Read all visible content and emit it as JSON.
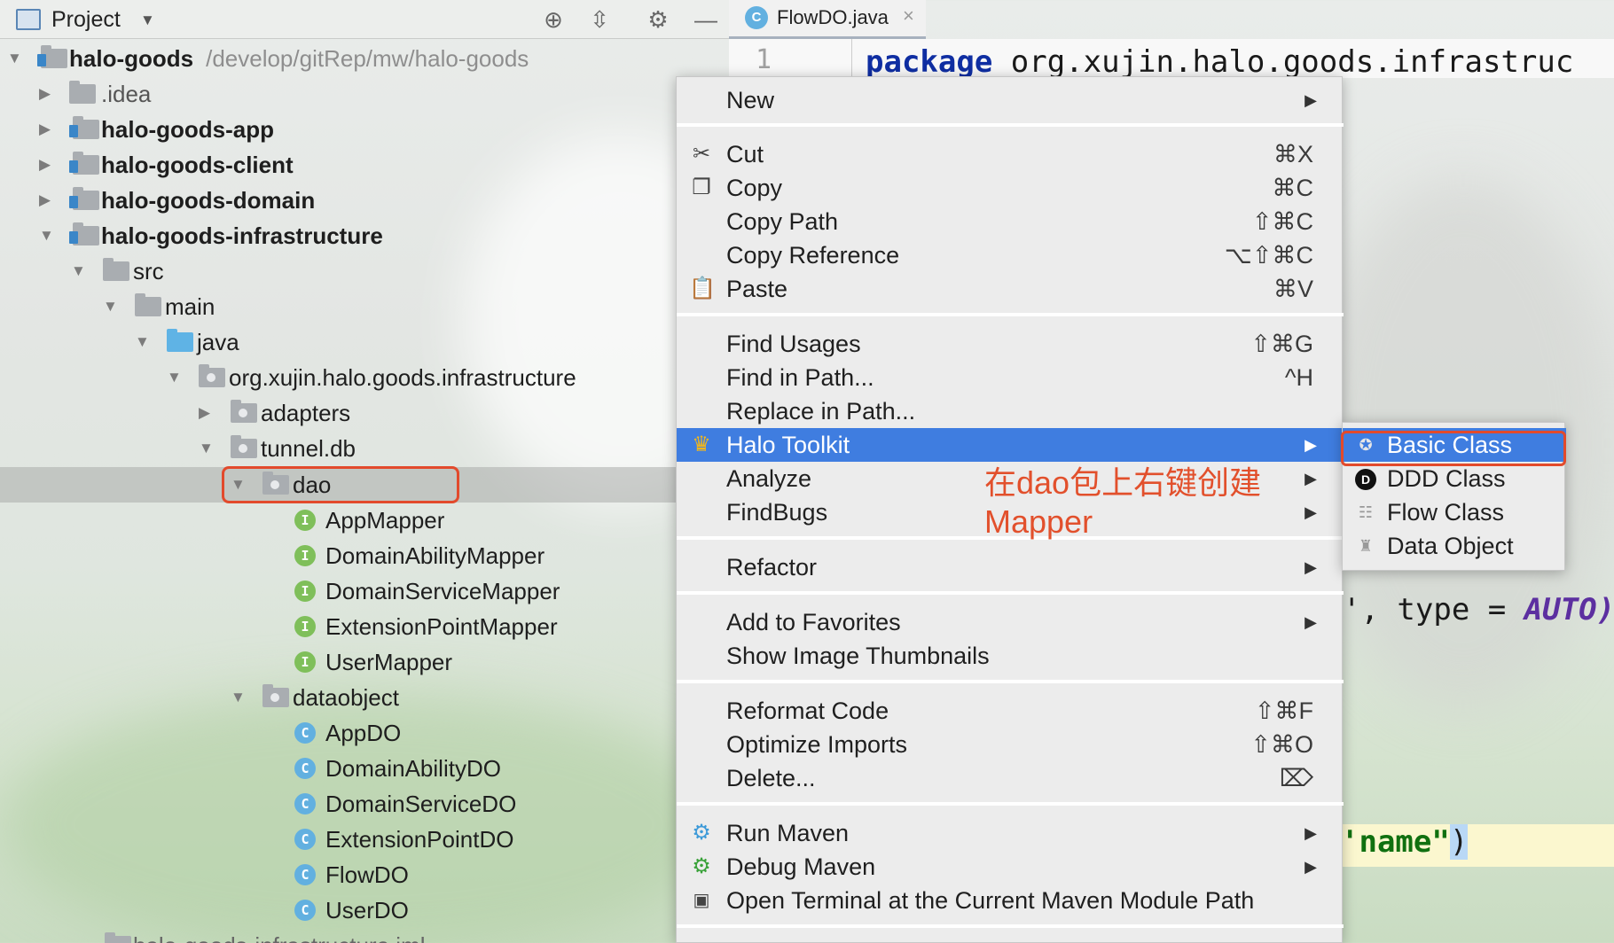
{
  "project_panel": {
    "title": "Project",
    "tree": [
      {
        "label": "halo-goods",
        "path": "/develop/gitRep/mw/halo-goods"
      },
      {
        "label": ".idea"
      },
      {
        "label": "halo-goods-app"
      },
      {
        "label": "halo-goods-client"
      },
      {
        "label": "halo-goods-domain"
      },
      {
        "label": "halo-goods-infrastructure"
      },
      {
        "label": "src"
      },
      {
        "label": "main"
      },
      {
        "label": "java"
      },
      {
        "label": "org.xujin.halo.goods.infrastructure"
      },
      {
        "label": "adapters"
      },
      {
        "label": "tunnel.db"
      },
      {
        "label": "dao"
      },
      {
        "label": "AppMapper",
        "badge": "I"
      },
      {
        "label": "DomainAbilityMapper",
        "badge": "I"
      },
      {
        "label": "DomainServiceMapper",
        "badge": "I"
      },
      {
        "label": "ExtensionPointMapper",
        "badge": "I"
      },
      {
        "label": "UserMapper",
        "badge": "I"
      },
      {
        "label": "dataobject"
      },
      {
        "label": "AppDO",
        "badge": "C"
      },
      {
        "label": "DomainAbilityDO",
        "badge": "C"
      },
      {
        "label": "DomainServiceDO",
        "badge": "C"
      },
      {
        "label": "ExtensionPointDO",
        "badge": "C"
      },
      {
        "label": "FlowDO",
        "badge": "C"
      },
      {
        "label": "UserDO",
        "badge": "C"
      },
      {
        "label": "halo-goods-infrastructure.iml"
      }
    ]
  },
  "editor": {
    "tab": {
      "icon": "C",
      "name": "FlowDO.java",
      "close": "×"
    },
    "line_number": "1",
    "line1_keyword": "package",
    "line1_rest": " org.xujin.halo.goods.infrastruc",
    "frag_type_pre": "', type = ",
    "frag_type_auto": "AUTO)",
    "frag_name": "'name\"",
    "frag_paren": ")"
  },
  "context_menu": {
    "new": "New",
    "cut": {
      "label": "Cut",
      "shortcut": "⌘X"
    },
    "copy": {
      "label": "Copy",
      "shortcut": "⌘C"
    },
    "copy_path": {
      "label": "Copy Path",
      "shortcut": "⇧⌘C"
    },
    "copy_reference": {
      "label": "Copy Reference",
      "shortcut": "⌥⇧⌘C"
    },
    "paste": {
      "label": "Paste",
      "shortcut": "⌘V"
    },
    "find_usages": {
      "label": "Find Usages",
      "shortcut": "⇧⌘G"
    },
    "find_in_path": {
      "label": "Find in Path...",
      "shortcut": "^H"
    },
    "replace_in_path": "Replace in Path...",
    "halo_toolkit": "Halo Toolkit",
    "analyze": "Analyze",
    "findbugs": "FindBugs",
    "refactor": "Refactor",
    "add_to_favorites": "Add to Favorites",
    "show_image_thumbnails": "Show Image Thumbnails",
    "reformat_code": {
      "label": "Reformat Code",
      "shortcut": "⇧⌘F"
    },
    "optimize_imports": {
      "label": "Optimize Imports",
      "shortcut": "⇧⌘O"
    },
    "delete": {
      "label": "Delete...",
      "shortcut": "⌦"
    },
    "run_maven": "Run Maven",
    "debug_maven": "Debug Maven",
    "open_terminal": "Open Terminal at the Current Maven Module Path"
  },
  "annotation": {
    "line1": "在dao包上右键创建",
    "line2": "Mapper"
  },
  "submenu": {
    "basic_class": "Basic Class",
    "ddd_class": "DDD Class",
    "ddd_icon_letter": "D",
    "flow_class": "Flow Class",
    "data_object": "Data Object"
  },
  "colors": {
    "highlight": "#3f7de0",
    "annotation": "#e2502c",
    "keyword": "#0f2ea2"
  }
}
